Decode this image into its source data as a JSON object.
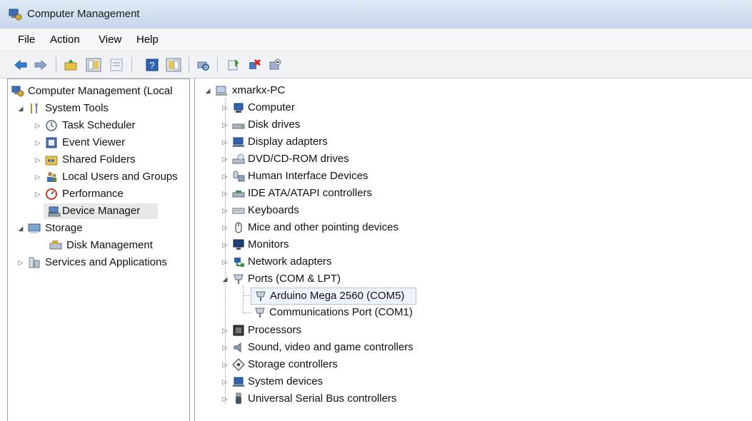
{
  "window": {
    "title": "Computer Management",
    "icon": "computer-management-icon"
  },
  "menu": {
    "file": "File",
    "action": "Action",
    "view": "View",
    "help": "Help"
  },
  "toolbar_icons": [
    "back-arrow-icon",
    "forward-arrow-icon",
    "up-folder-icon",
    "show-hide-tree-icon",
    "properties-icon",
    "help-icon",
    "show-hide-action-pane-icon",
    "scan-hardware-icon",
    "update-driver-icon",
    "uninstall-icon",
    "disable-device-icon"
  ],
  "left_tree": {
    "root": "Computer Management (Local",
    "system_tools": "System Tools",
    "task_scheduler": "Task Scheduler",
    "event_viewer": "Event Viewer",
    "shared_folders": "Shared Folders",
    "local_users": "Local Users and Groups",
    "performance": "Performance",
    "device_manager": "Device Manager",
    "storage": "Storage",
    "disk_management": "Disk Management",
    "services": "Services and Applications"
  },
  "device_tree": {
    "root": "xmarkx-PC",
    "categories": {
      "computer": "Computer",
      "disk_drives": "Disk drives",
      "display_adapters": "Display adapters",
      "dvd": "DVD/CD-ROM drives",
      "hid": "Human Interface Devices",
      "ide": "IDE ATA/ATAPI controllers",
      "keyboards": "Keyboards",
      "mice": "Mice and other pointing devices",
      "monitors": "Monitors",
      "network": "Network adapters",
      "ports": "Ports (COM & LPT)",
      "processors": "Processors",
      "sound": "Sound, video and game controllers",
      "storage_ctrl": "Storage controllers",
      "system_devices": "System devices",
      "usb": "Universal Serial Bus controllers"
    },
    "ports_children": {
      "arduino": "Arduino Mega 2560 (COM5)",
      "comm": "Communications Port (COM1)"
    }
  },
  "colors": {
    "titlebar": "#c7d7ec",
    "selection": "#eef4fb",
    "accent": "#2f6fb8"
  }
}
